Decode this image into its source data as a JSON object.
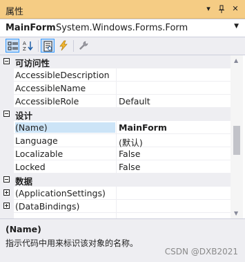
{
  "titlebar": {
    "title": "属性",
    "dropdown_glyph": "▾",
    "pin_glyph": "ᵖ",
    "close_glyph": "✕"
  },
  "object_selector": {
    "name": "MainForm",
    "type": "System.Windows.Forms.Form"
  },
  "toolbar": {
    "buttons": [
      {
        "icon": "categorized-icon",
        "active": true
      },
      {
        "icon": "alphabetical-icon",
        "active": false
      },
      {
        "icon": "properties-icon",
        "active": true
      },
      {
        "icon": "events-lightning-icon",
        "active": false
      },
      {
        "icon": "property-pages-wrench-icon",
        "active": false
      }
    ]
  },
  "grid": {
    "cat_access": "可访问性",
    "cat_design": "设计",
    "cat_data": "数据",
    "accessible_description": "AccessibleDescription",
    "accessible_name": "AccessibleName",
    "accessible_role": "AccessibleRole",
    "accessible_role_value": "Default",
    "name": "(Name)",
    "name_value": "MainForm",
    "language": "Language",
    "language_value": "(默认)",
    "localizable": "Localizable",
    "localizable_value": "False",
    "locked": "Locked",
    "locked_value": "False",
    "application_settings": "(ApplicationSettings)",
    "data_bindings": "(DataBindings)"
  },
  "description": {
    "title": "(Name)",
    "text": "指示代码中用来标识该对象的名称。"
  },
  "watermark": "CSDN @DXB2021",
  "colors": {
    "titlebar": "#f5cc84",
    "selection": "#cce4f7",
    "panel": "#eeeef2",
    "accent_blue": "#3399ff"
  }
}
